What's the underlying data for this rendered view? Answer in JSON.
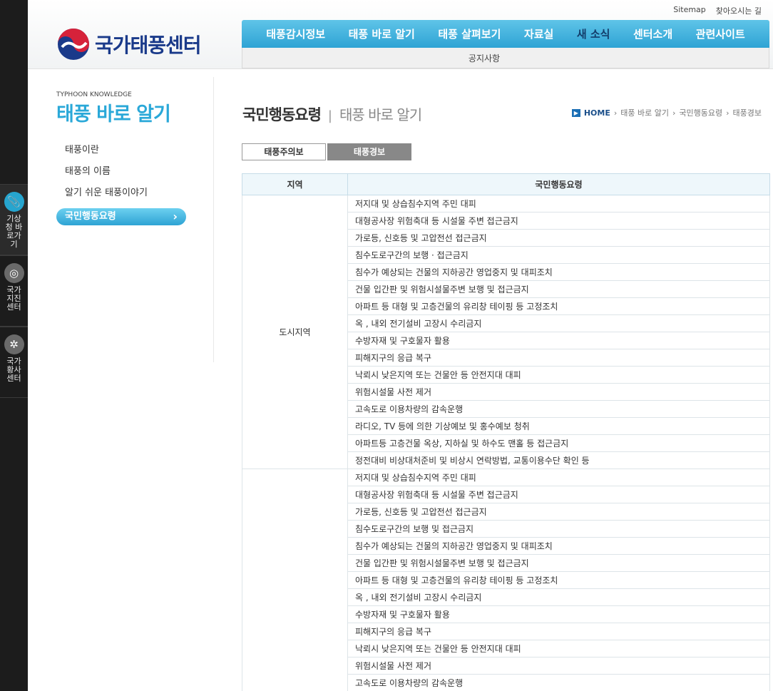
{
  "quickbar": {
    "items": [
      {
        "label": "기상청 바로가기",
        "icon": "paperclip-icon",
        "color": "#26a5cf"
      },
      {
        "label": "국가 지진센터",
        "icon": "target-icon",
        "color": "#6a6a6a"
      },
      {
        "label": "국가 황사센터",
        "icon": "flower-icon",
        "color": "#6a6a6a"
      }
    ]
  },
  "header": {
    "util": {
      "sitemap": "Sitemap",
      "directions": "찾아오시는 길"
    },
    "logo_text": "국가태풍센터",
    "gnb": [
      "태풍감시정보",
      "태풍 바로 알기",
      "태풍 살펴보기",
      "자료실",
      "새 소식",
      "센터소개",
      "관련사이트"
    ],
    "gnb_active_index": 4,
    "subnav": "공지사항",
    "colors": {
      "gnb": "#2ea3d4",
      "logo_blue": "#1a3a8a",
      "logo_red": "#d6223a"
    }
  },
  "sidebar": {
    "eyebrow": "TYPHOON KNOWLEDGE",
    "title": "태풍 바로 알기",
    "items": [
      "태풍이란",
      "태풍의 이름",
      "알기 쉬운 태풍이야기",
      "국민행동요령"
    ],
    "active_index": 3
  },
  "main": {
    "title": "국민행동요령",
    "separator": "|",
    "subtitle": "태풍 바로 알기",
    "breadcrumb": {
      "home": "HOME",
      "items": [
        "태풍 바로 알기",
        "국민행동요령",
        "태풍경보"
      ]
    },
    "tabs": [
      {
        "label": "태풍주의보",
        "active": false
      },
      {
        "label": "태풍경보",
        "active": true
      }
    ],
    "table": {
      "headers": [
        "지역",
        "국민행동요령"
      ],
      "groups": [
        {
          "region": "도시지역",
          "actions": [
            "저지대 및 상습침수지역 주민 대피",
            "대형공사장 위험축대 등 시설물 주변 접근금지",
            "가로등, 신호등 및 고압전선 접근금지",
            "침수도로구간의 보행 · 접근금지",
            "침수가 예상되는 건물의 지하공간 영업중지 및 대피조치",
            "건물 입간판 및 위험시설물주변 보행 및 접근금지",
            "아파트 등 대형 및 고층건물의 유리창 테이핑 등 고정조치",
            "옥 , 내외 전기설비 고장시 수리금지",
            "수방자재 및 구호물자 활용",
            "피해지구의 응급 복구",
            "낙뢰시 낮은지역 또는 건물안 등 안전지대 대피",
            "위험시설물 사전 제거",
            "고속도로 이용차량의 감속운행",
            "라디오, TV 등에 의한 기상예보 및 홍수예보 청취",
            "아파트등 고층건물 옥상, 지하실 및 하수도 맨홀 등 접근금지",
            "정전대비 비상대처준비 및 비상시 연락방법, 교통이용수단 확인 등"
          ]
        },
        {
          "region": "",
          "actions": [
            "저지대 및 상습침수지역 주민 대피",
            "대형공사장 위험축대 등 시설물 주변 접근금지",
            "가로등, 신호등 및 고압전선 접근금지",
            "침수도로구간의 보행 및 접근금지",
            "침수가 예상되는 건물의 지하공간 영업중지 및 대피조치",
            "건물 입간판 및 위험시설물주변 보행 및 접근금지",
            "아파트 등 대형 및 고층건물의 유리창 테이핑 등 고정조치",
            "옥 , 내외 전기설비 고장시 수리금지",
            "수방자재 및 구호물자 활용",
            "피해지구의 응급 복구",
            "낙뢰시 낮은지역 또는 건물안 등 안전지대 대피",
            "위험시설물 사전 제거",
            "고속도로 이용차량의 감속운행"
          ]
        }
      ]
    }
  }
}
